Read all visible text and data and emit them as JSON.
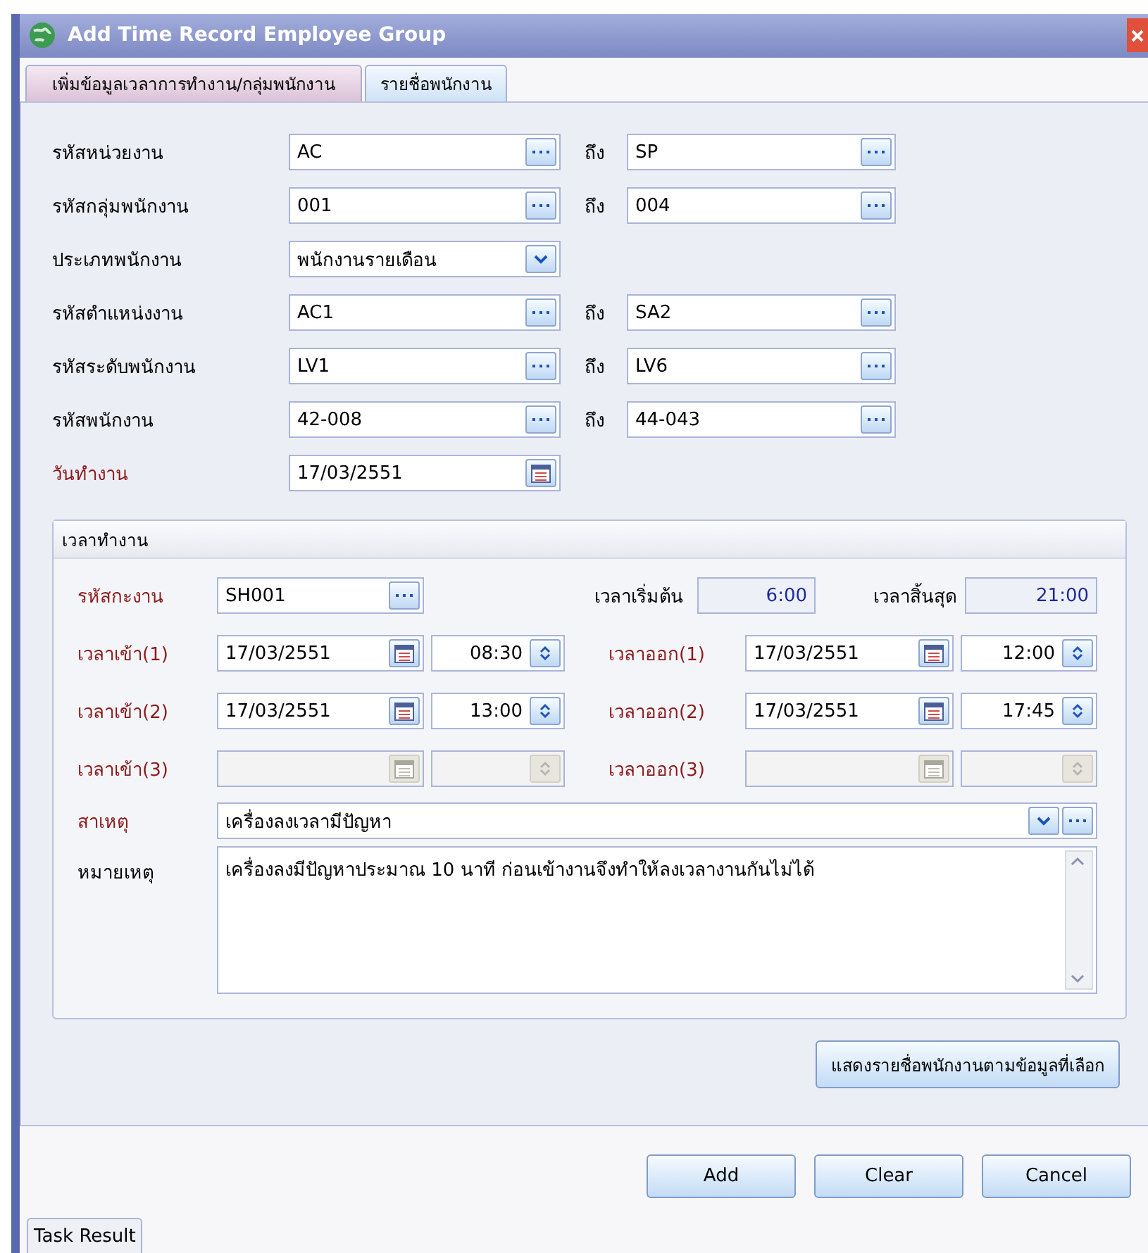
{
  "window": {
    "title": "Add Time Record Employee Group"
  },
  "tabs": [
    {
      "label": "เพิ่มข้อมูลเวลาการทำงาน/กลุ่มพนักงาน",
      "selected": true
    },
    {
      "label": "รายชื่อพนักงาน",
      "selected": false
    }
  ],
  "criteria": [
    {
      "kind": "range",
      "label": "รหัสหน่วยงาน",
      "required": false,
      "value": "AC",
      "to_label": "ถึง",
      "to_value": "SP"
    },
    {
      "kind": "range",
      "label": "รหัสกลุ่มพนักงาน",
      "required": false,
      "value": "001",
      "to_label": "ถึง",
      "to_value": "004"
    },
    {
      "kind": "combo",
      "label": "ประเภทพนักงาน",
      "required": false,
      "value": "พนักงานรายเดือน"
    },
    {
      "kind": "range",
      "label": "รหัสตำแหน่งงาน",
      "required": false,
      "value": "AC1",
      "to_label": "ถึง",
      "to_value": "SA2"
    },
    {
      "kind": "range",
      "label": "รหัสระดับพนักงาน",
      "required": false,
      "value": "LV1",
      "to_label": "ถึง",
      "to_value": "LV6"
    },
    {
      "kind": "range",
      "label": "รหัสพนักงาน",
      "required": false,
      "value": "42-008",
      "to_label": "ถึง",
      "to_value": "44-043"
    },
    {
      "kind": "date",
      "label": "วันทำงาน",
      "required": true,
      "value": "17/03/2551"
    }
  ],
  "work_time": {
    "title": "เวลาทำงาน",
    "shift": {
      "label": "รหัสกะงาน",
      "required": true,
      "value": "SH001"
    },
    "start": {
      "label": "เวลาเริ่มต้น",
      "value": "6:00"
    },
    "end": {
      "label": "เวลาสิ้นสุด",
      "value": "21:00"
    },
    "periods": [
      {
        "in_label": "เวลาเข้า(1)",
        "in_date": "17/03/2551",
        "in_time": "08:30",
        "out_label": "เวลาออก(1)",
        "out_date": "17/03/2551",
        "out_time": "12:00",
        "disabled": false
      },
      {
        "in_label": "เวลาเข้า(2)",
        "in_date": "17/03/2551",
        "in_time": "13:00",
        "out_label": "เวลาออก(2)",
        "out_date": "17/03/2551",
        "out_time": "17:45",
        "disabled": false
      },
      {
        "in_label": "เวลาเข้า(3)",
        "out_label": "เวลาออก(3)",
        "disabled": true
      }
    ],
    "reason": {
      "label": "สาเหตุ",
      "required": true,
      "value": "เครื่องลงเวลามีปัญหา"
    },
    "note": {
      "label": "หมายเหตุ",
      "required": false,
      "value": "เครื่องลงมีปัญหาประมาณ 10 นาที ก่อนเข้างานจึงทำให้ลงเวลางานกันไม่ได้"
    }
  },
  "show_button": "แสดงรายชื่อพนักงานตามข้อมูลที่เลือก",
  "buttons": [
    "Add",
    "Clear",
    "Cancel"
  ],
  "task_tab": "Task Result"
}
